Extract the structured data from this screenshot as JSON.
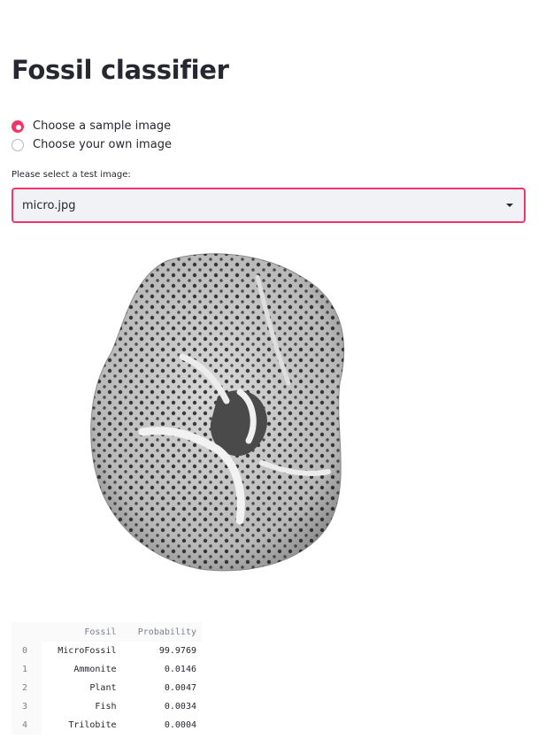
{
  "page": {
    "title": "Fossil classifier"
  },
  "radio": {
    "options": [
      "Choose a sample image",
      "Choose your own image"
    ],
    "selected_index": 0
  },
  "select": {
    "label": "Please select a test image:",
    "value": "micro.jpg"
  },
  "image": {
    "subject": "microfossil (foraminifera) grayscale photo"
  },
  "table": {
    "columns": [
      "",
      "Fossil",
      "Probability"
    ],
    "rows": [
      {
        "index": "0",
        "fossil": "MicroFossil",
        "probability": "99.9769"
      },
      {
        "index": "1",
        "fossil": "Ammonite",
        "probability": "0.0146"
      },
      {
        "index": "2",
        "fossil": "Plant",
        "probability": "0.0047"
      },
      {
        "index": "3",
        "fossil": "Fish",
        "probability": "0.0034"
      },
      {
        "index": "4",
        "fossil": "Trilobite",
        "probability": "0.0004"
      }
    ]
  },
  "colors": {
    "accent": "#f63366",
    "text": "#262730",
    "select_bg": "#f0f2f6"
  }
}
